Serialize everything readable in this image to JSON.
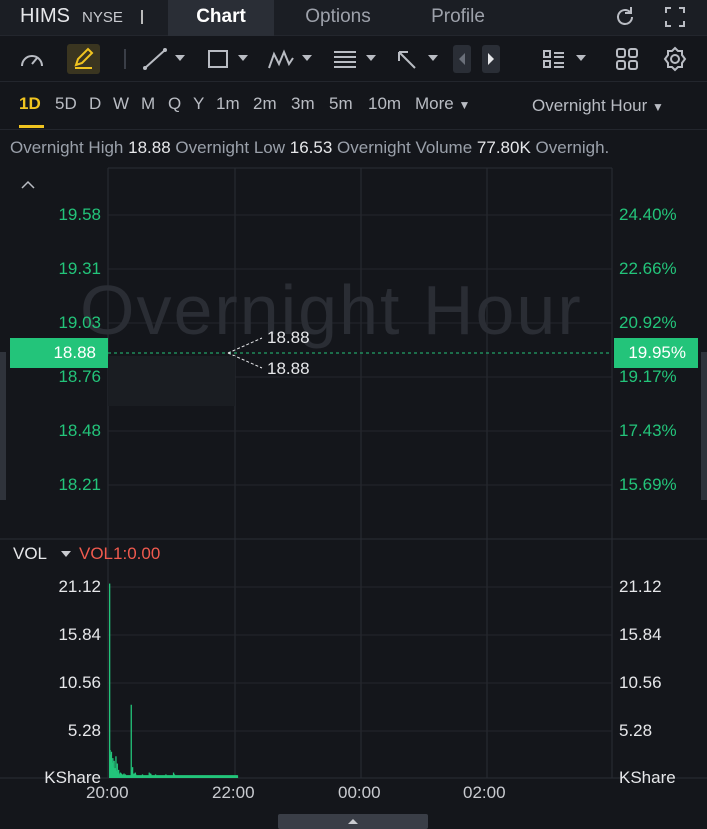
{
  "header": {
    "ticker": "HIMS",
    "exchange": "NYSE",
    "tabs": [
      {
        "label": "Chart",
        "active": true
      },
      {
        "label": "Options",
        "active": false
      },
      {
        "label": "Profile",
        "active": false
      }
    ],
    "icons": [
      "refresh-icon",
      "fullscreen-icon"
    ]
  },
  "toolbar": {
    "tools": [
      "gauge-icon",
      "pencil-icon",
      "trendline-icon",
      "rectangle-icon",
      "pattern-icon",
      "fib-icon",
      "arrow-icon",
      "prev-icon",
      "next-icon",
      "list-icon",
      "grid-icon",
      "settings-icon"
    ]
  },
  "periods": {
    "items": [
      "1D",
      "5D",
      "D",
      "W",
      "M",
      "Q",
      "Y",
      "1m",
      "2m",
      "3m",
      "5m",
      "10m"
    ],
    "active": "1D",
    "more_label": "More",
    "session_label": "Overnight Hour"
  },
  "stats": {
    "high_label": "Overnight High",
    "high_value": "18.88",
    "low_label": "Overnight Low",
    "low_value": "16.53",
    "volume_label": "Overnight Volume",
    "volume_value": "77.80K",
    "more_label": "Overnigh."
  },
  "price_chart": {
    "watermark": "Overnight Hour",
    "left_ticks": [
      "19.58",
      "19.31",
      "19.03",
      "18.76",
      "18.48",
      "18.21"
    ],
    "right_ticks": [
      "24.40%",
      "22.66%",
      "20.92%",
      "19.17%",
      "17.43%",
      "15.69%"
    ],
    "current_price": "18.88",
    "current_pct": "19.95%",
    "annotation_high": "18.88",
    "annotation_low": "18.88",
    "accent_color": "#23c47a"
  },
  "volume_chart": {
    "indicator": "VOL",
    "vol1_label": "VOL1:0.00",
    "left_ticks": [
      "21.12",
      "15.84",
      "10.56",
      "5.28"
    ],
    "right_ticks": [
      "21.12",
      "15.84",
      "10.56",
      "5.28"
    ],
    "unit_left": "KShare",
    "unit_right": "KShare"
  },
  "time_axis": [
    "20:00",
    "22:00",
    "00:00",
    "02:00"
  ],
  "chart_data": {
    "type": "bar",
    "title": "",
    "ylabel": "KShare",
    "ylim": [
      0,
      21.12
    ],
    "x_ticks": [
      "20:00",
      "22:00",
      "00:00",
      "02:00"
    ],
    "values": [
      21.5,
      3.1,
      2.6,
      1.4,
      2.9,
      1.7,
      0.9,
      2.2,
      1.2,
      0.8,
      1.9,
      0.7,
      1.1,
      0.6,
      2.4,
      0.5,
      0.8,
      1.6,
      0.6,
      0.4,
      0.9,
      0.5,
      0.3,
      0.4,
      0.6,
      0.3,
      0.5,
      0.4,
      0.3,
      0.3,
      0.4,
      0.3,
      0.5,
      0.3,
      0.3,
      0.4,
      0.3,
      0.3,
      0.3,
      0.3,
      0.3,
      0.3,
      0.3,
      0.3,
      0.3,
      0.3,
      0.3,
      0.3,
      8.1,
      0.4,
      0.9,
      1.2,
      0.5,
      0.4,
      0.4,
      0.5,
      0.3,
      0.6,
      0.4,
      0.3,
      0.3,
      0.3,
      0.3,
      0.3,
      0.3,
      0.3,
      0.3,
      0.3,
      0.3,
      0.3,
      0.3,
      0.3,
      0.3,
      0.4,
      0.3,
      0.3,
      0.3,
      0.3,
      0.3,
      0.3,
      0.3,
      0.3,
      0.3,
      0.3,
      0.3,
      0.3,
      0.3,
      0.3,
      0.6,
      0.4,
      0.3,
      0.5,
      0.4,
      0.3,
      0.3,
      0.3,
      0.3,
      0.3,
      0.3,
      0.3,
      0.3,
      0.3,
      0.4,
      0.3,
      0.3,
      0.3,
      0.3,
      0.3,
      0.3,
      0.3,
      0.3,
      0.3,
      0.3,
      0.3,
      0.3,
      0.3,
      0.3,
      0.3,
      0.3,
      0.3,
      0.3,
      0.3,
      0.3,
      0.3,
      0.3,
      0.4,
      0.3,
      0.3,
      0.3,
      0.3,
      0.3,
      0.3,
      0.3,
      0.3,
      0.3,
      0.3,
      0.3,
      0.3,
      0.3,
      0.3,
      0.3,
      0.3,
      0.6,
      0.3,
      0.4,
      0.3,
      0.3,
      0.3,
      0.3,
      0.3,
      0.3,
      0.3,
      0.3,
      0.3,
      0.3,
      0.3,
      0.3,
      0.3,
      0.3,
      0.3,
      0.3,
      0.3,
      0.3,
      0.3,
      0.3,
      0.3,
      0.3,
      0.3,
      0.3,
      0.3,
      0.3,
      0.3,
      0.3,
      0.3,
      0.3,
      0.3,
      0.3,
      0.3,
      0.3,
      0.3,
      0.3,
      0.3,
      0.3,
      0.3,
      0.3,
      0.3,
      0.3,
      0.3,
      0.3,
      0.3,
      0.3,
      0.3,
      0.3,
      0.3,
      0.3,
      0.3,
      0.3,
      0.3,
      0.3,
      0.3,
      0.3,
      0.3,
      0.3,
      0.3,
      0.3,
      0.3,
      0.3,
      0.3,
      0.3,
      0.3,
      0.3,
      0.3,
      0.3,
      0.3,
      0.3,
      0.3,
      0.3,
      0.3,
      0.3,
      0.3,
      0.3,
      0.3,
      0.3,
      0.3,
      0.3,
      0.3,
      0.3,
      0.3,
      0.3,
      0.3,
      0.3,
      0.3,
      0.3,
      0.3,
      0.3,
      0.3,
      0.3,
      0.3,
      0.3,
      0.3,
      0.3,
      0.3,
      0.3,
      0.3,
      0.3,
      0.3,
      0.3,
      0.3,
      0.3,
      0.3,
      0.3,
      0.3,
      0.3,
      0.3,
      0.3,
      0.3,
      0.3,
      0.3,
      0.3,
      0.3,
      0.3,
      0.3,
      0.3,
      0.3,
      0.3,
      0.3,
      0.3,
      0.3,
      0.3,
      0.3,
      0.3,
      0.3,
      0.3,
      0.3,
      0.3,
      0.3,
      0.3,
      0.3,
      0.3,
      0.3,
      0.3,
      0.3,
      0.3,
      0.3,
      0.3
    ]
  }
}
